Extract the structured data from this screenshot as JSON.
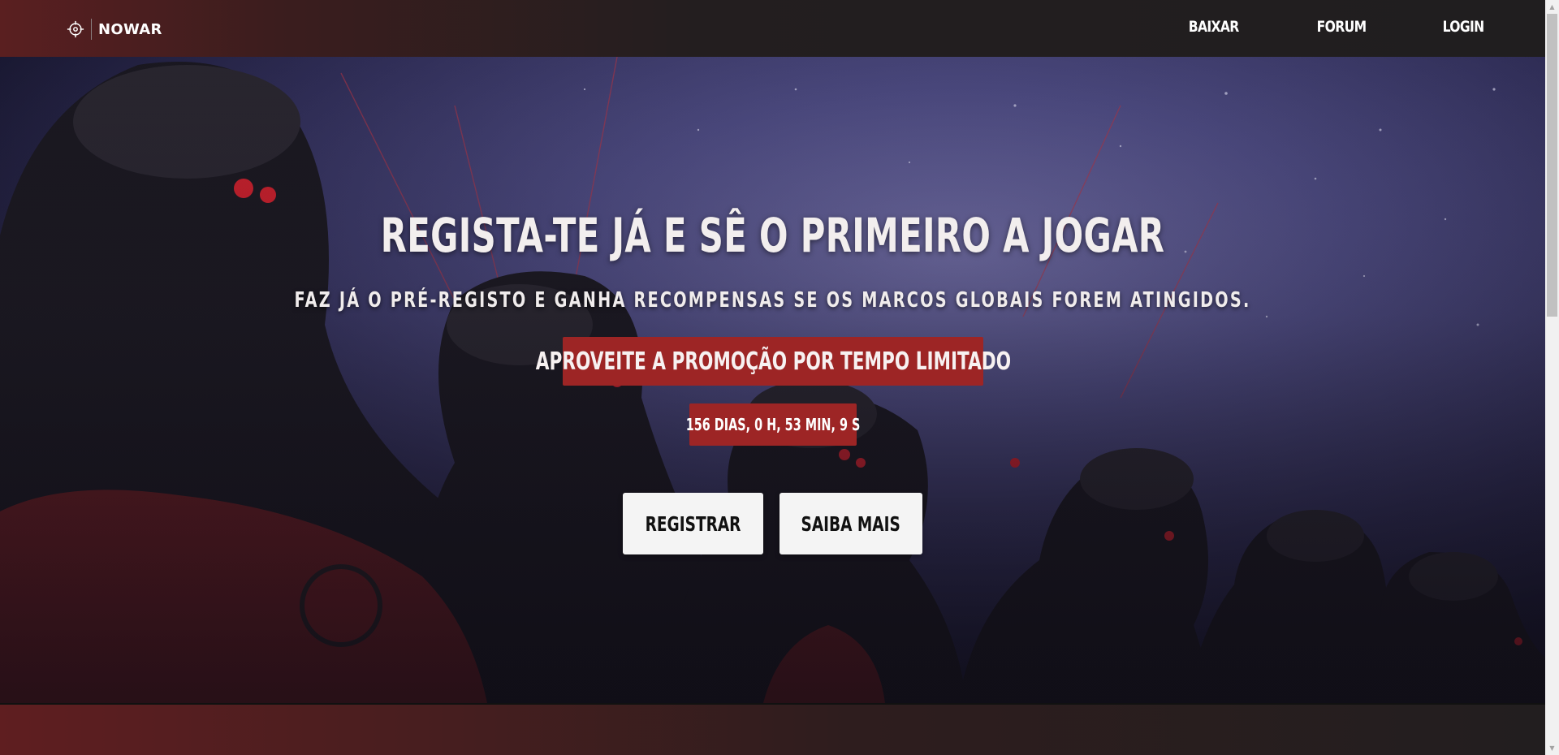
{
  "brand": {
    "name": "NOWAR",
    "icon": "crosshair-icon"
  },
  "nav": {
    "items": [
      {
        "label": "BAIXAR"
      },
      {
        "label": "FORUM"
      },
      {
        "label": "LOGIN"
      }
    ]
  },
  "hero": {
    "title": "REGISTA-TE JÁ E SÊ O PRIMEIRO A JOGAR",
    "subtitle": "FAZ JÁ O PRÉ-REGISTO E GANHA RECOMPENSAS SE OS MARCOS GLOBAIS FOREM ATINGIDOS.",
    "promo": "APROVEITE A PROMOÇÃO POR TEMPO LIMITADO",
    "countdown": "156 DIAS, 0 H, 53 MIN, 9 S",
    "buttons": {
      "register": "REGISTRAR",
      "more": "SAIBA MAIS"
    },
    "background": "soldiers-artwork"
  },
  "colors": {
    "accent": "#9d2525",
    "nav_bg": "#201e1f",
    "brand_red": "#5a1f20",
    "button_bg": "#f4f4f4",
    "sky": "#4c4b85"
  }
}
